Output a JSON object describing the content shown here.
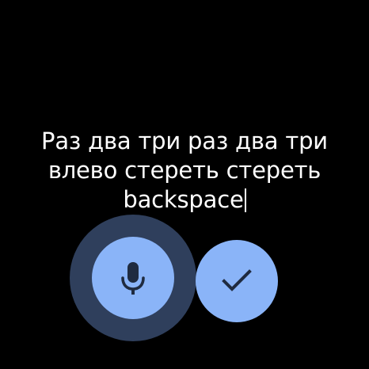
{
  "transcript": {
    "line1": "Раз два три раз два три",
    "line2": "влево стереть стереть",
    "line3": "backspace"
  },
  "icons": {
    "mic": "microphone-icon",
    "confirm": "checkmark-icon"
  },
  "colors": {
    "background": "#000000",
    "text": "#ffffff",
    "button": "#8ab4f8",
    "mic_halo": "#2f3f5c",
    "icon": "#1f2b40"
  }
}
